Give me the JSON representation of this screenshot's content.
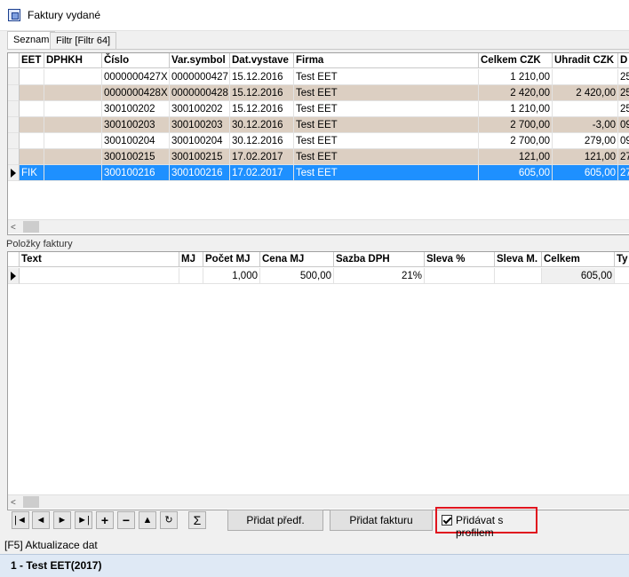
{
  "window": {
    "title": "Faktury vydané"
  },
  "tabs": [
    {
      "label": "Seznam"
    },
    {
      "label": "Filtr [Filtr 64]"
    }
  ],
  "invoices": {
    "columns": [
      "EET",
      "DPHKH",
      "Číslo",
      "Var.symbol",
      "Dat.vystave",
      "Firma",
      "Celkem CZK",
      "Uhradit CZK",
      "D"
    ],
    "rows": [
      {
        "eet": "",
        "dphkh": "",
        "cislo": "0000000427X",
        "vs": "0000000427",
        "datum": "15.12.2016",
        "firma": "Test EET",
        "celkem": "1 210,00",
        "uhradit": "",
        "d": "25"
      },
      {
        "eet": "",
        "dphkh": "",
        "cislo": "0000000428X",
        "vs": "0000000428",
        "datum": "15.12.2016",
        "firma": "Test EET",
        "celkem": "2 420,00",
        "uhradit": "2 420,00",
        "d": "25"
      },
      {
        "eet": "",
        "dphkh": "",
        "cislo": "300100202",
        "vs": "300100202",
        "datum": "15.12.2016",
        "firma": "Test EET",
        "celkem": "1 210,00",
        "uhradit": "",
        "d": "25"
      },
      {
        "eet": "",
        "dphkh": "",
        "cislo": "300100203",
        "vs": "300100203",
        "datum": "30.12.2016",
        "firma": "Test EET",
        "celkem": "2 700,00",
        "uhradit": "-3,00",
        "d": "09"
      },
      {
        "eet": "",
        "dphkh": "",
        "cislo": "300100204",
        "vs": "300100204",
        "datum": "30.12.2016",
        "firma": "Test EET",
        "celkem": "2 700,00",
        "uhradit": "279,00",
        "d": "09"
      },
      {
        "eet": "",
        "dphkh": "",
        "cislo": "300100215",
        "vs": "300100215",
        "datum": "17.02.2017",
        "firma": "Test EET",
        "celkem": "121,00",
        "uhradit": "121,00",
        "d": "27"
      },
      {
        "eet": "FIK",
        "dphkh": "",
        "cislo": "300100216",
        "vs": "300100216",
        "datum": "17.02.2017",
        "firma": "Test EET",
        "celkem": "605,00",
        "uhradit": "605,00",
        "d": "27"
      }
    ]
  },
  "items": {
    "label": "Položky faktury",
    "columns": [
      "Text",
      "MJ",
      "Počet MJ",
      "Cena MJ",
      "Sazba DPH",
      "Sleva %",
      "Sleva M.",
      "Celkem",
      "Ty"
    ],
    "rows": [
      {
        "text": "",
        "mj": "",
        "pocet": "1,000",
        "cena": "500,00",
        "sazba": "21%",
        "sleva_pct": "",
        "sleva_m": "",
        "celkem": "605,00",
        "ty": ""
      }
    ]
  },
  "toolbar": {
    "nav": [
      "|◄",
      "◄",
      "►",
      "►|",
      "+",
      "−",
      "▲",
      "↻",
      "Σ"
    ],
    "pridat_predf": "Přidat předf.",
    "pridat_fakturu": "Přidat fakturu",
    "pridavat_profilem": "Přidávat s profilem",
    "pridavat_checked": true
  },
  "status": {
    "f5": "[F5] Aktualizace dat",
    "bottom": "1 - Test EET(2017)"
  },
  "colors": {
    "row_alt": "#dccfc2",
    "row_selected": "#1e90ff",
    "highlight_border": "#e0141e"
  }
}
